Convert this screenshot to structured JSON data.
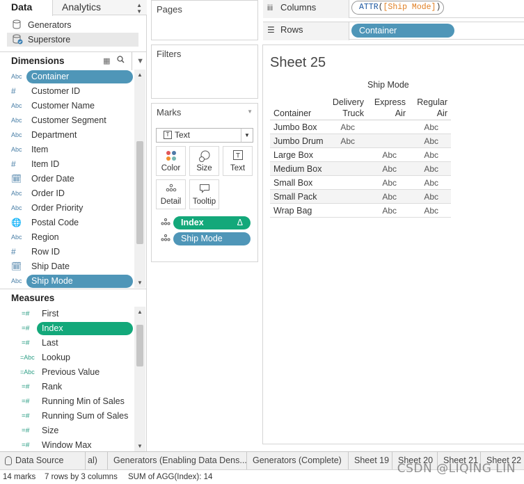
{
  "left_pane": {
    "tabs": {
      "data": "Data",
      "analytics": "Analytics"
    },
    "datasources": [
      "Generators",
      "Superstore"
    ],
    "dimensions_title": "Dimensions",
    "dimensions": [
      {
        "type": "Abc",
        "label": "Container"
      },
      {
        "type": "#",
        "label": "Customer ID"
      },
      {
        "type": "Abc",
        "label": "Customer Name"
      },
      {
        "type": "Abc",
        "label": "Customer Segment"
      },
      {
        "type": "Abc",
        "label": "Department"
      },
      {
        "type": "Abc",
        "label": "Item"
      },
      {
        "type": "#",
        "label": "Item ID"
      },
      {
        "type": "date",
        "label": "Order Date"
      },
      {
        "type": "Abc",
        "label": "Order ID"
      },
      {
        "type": "Abc",
        "label": "Order Priority"
      },
      {
        "type": "globe",
        "label": "Postal Code"
      },
      {
        "type": "Abc",
        "label": "Region"
      },
      {
        "type": "#",
        "label": "Row ID"
      },
      {
        "type": "date",
        "label": "Ship Date"
      },
      {
        "type": "Abc",
        "label": "Ship Mode"
      }
    ],
    "measures_title": "Measures",
    "measures": [
      {
        "type": "=#",
        "label": "First"
      },
      {
        "type": "=#",
        "label": "Index"
      },
      {
        "type": "=#",
        "label": "Last"
      },
      {
        "type": "=Abc",
        "label": "Lookup"
      },
      {
        "type": "=Abc",
        "label": "Previous Value"
      },
      {
        "type": "=#",
        "label": "Rank"
      },
      {
        "type": "=#",
        "label": "Running Min of Sales"
      },
      {
        "type": "=#",
        "label": "Running Sum of Sales"
      },
      {
        "type": "=#",
        "label": "Size"
      },
      {
        "type": "=#",
        "label": "Window Max"
      }
    ]
  },
  "shelves": {
    "pages": "Pages",
    "filters": "Filters",
    "marks": "Marks",
    "mark_type": "Text",
    "mark_buttons": {
      "color": "Color",
      "size": "Size",
      "text": "Text",
      "detail": "Detail",
      "tooltip": "Tooltip"
    },
    "mark_pills": {
      "index": "Index",
      "index_symbol": "Δ",
      "ship_mode": "Ship Mode"
    },
    "columns_label": "Columns",
    "columns_pill": {
      "fn": "ATTR",
      "open": "(",
      "arg": "[Ship Mode]",
      "close": ")"
    },
    "rows_label": "Rows",
    "rows_pill": "Container"
  },
  "view": {
    "sheet_title": "Sheet 25",
    "column_group_header": "Ship Mode",
    "row_header": "Container",
    "columns": [
      {
        "line1": "Delivery",
        "line2": "Truck"
      },
      {
        "line1": "Express",
        "line2": "Air"
      },
      {
        "line1": "Regular",
        "line2": "Air"
      }
    ],
    "rows": [
      {
        "label": "Jumbo Box",
        "cells": [
          "Abc",
          "",
          "Abc"
        ]
      },
      {
        "label": "Jumbo Drum",
        "cells": [
          "Abc",
          "",
          "Abc"
        ]
      },
      {
        "label": "Large Box",
        "cells": [
          "",
          "Abc",
          "Abc"
        ]
      },
      {
        "label": "Medium Box",
        "cells": [
          "",
          "Abc",
          "Abc"
        ]
      },
      {
        "label": "Small Box",
        "cells": [
          "",
          "Abc",
          "Abc"
        ]
      },
      {
        "label": "Small Pack",
        "cells": [
          "",
          "Abc",
          "Abc"
        ]
      },
      {
        "label": "Wrap Bag",
        "cells": [
          "",
          "Abc",
          "Abc"
        ]
      }
    ]
  },
  "sheet_tabs": {
    "data_source": "Data Source",
    "tabs": [
      "al)",
      "Generators (Enabling Data Dens...",
      "Generators (Complete)",
      "Sheet 19",
      "Sheet 20",
      "Sheet 21",
      "Sheet 22"
    ]
  },
  "status_bar": {
    "marks": "14 marks",
    "rows_cols": "7 rows by 3 columns",
    "sum": "SUM of AGG(Index): 14"
  },
  "watermark": "CSDN @LIQING LIN",
  "colors": {
    "dimension_pill": "#4f96b8",
    "measure_pill": "#13a87a"
  }
}
